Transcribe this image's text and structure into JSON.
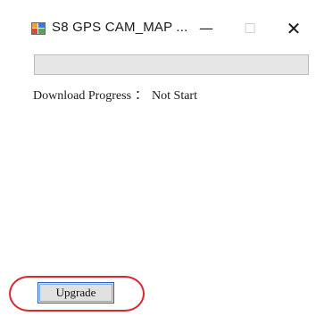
{
  "window": {
    "title": "S8 GPS CAM_MAP ...",
    "app_icon": "windows-app-icon",
    "controls": {
      "minimize_icon": "minimize-icon",
      "minimize_glyph": "—",
      "maximize_icon": "maximize-icon",
      "maximize_glyph": "☐",
      "close_icon": "close-icon",
      "close_glyph": "✕"
    }
  },
  "download": {
    "progress_fraction": 0,
    "label": "Download Progress",
    "separator": "：",
    "status": "Not Start"
  },
  "actions": {
    "upgrade_label": "Upgrade"
  },
  "colors": {
    "progress_track": "#e6e6e6",
    "progress_fill": "#06b025",
    "button_border": "#2a5fb8",
    "highlight": "#d9282f"
  }
}
